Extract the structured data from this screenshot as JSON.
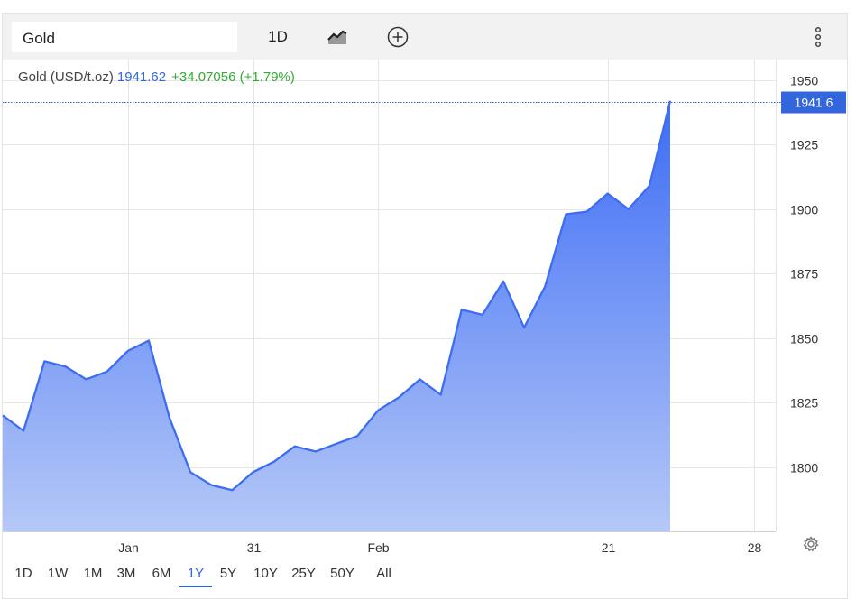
{
  "toolbar": {
    "symbol": "Gold",
    "interval": "1D",
    "chart_type_icon": "mountain-chart-icon",
    "compare_icon": "plus-circle-icon",
    "menu_icon": "vertical-ellipsis-icon"
  },
  "legend": {
    "name": "Gold (USD/t.oz)",
    "price": "1941.62",
    "change": "+34.07056 (+1.79%)"
  },
  "colors": {
    "line": "#3d6df0",
    "area_top": "#3d6cf5",
    "area_bottom": "#b5c8f7",
    "price_tag": "#3366dd",
    "change_positive": "#33aa33",
    "grid": "#e6e6e6"
  },
  "ranges": [
    "1D",
    "1W",
    "1M",
    "3M",
    "6M",
    "1Y",
    "5Y",
    "10Y",
    "25Y",
    "50Y",
    "All"
  ],
  "active_range": "1Y",
  "settings_icon": "gear-icon",
  "chart_data": {
    "type": "area",
    "title": "",
    "xlabel": "",
    "ylabel": "",
    "ylim": [
      1775,
      1958
    ],
    "grid": true,
    "y_ticks": [
      "1950",
      "1925",
      "1900",
      "1875",
      "1850",
      "1825",
      "1800"
    ],
    "x_ticks": [
      {
        "label": "Jan",
        "x": 6
      },
      {
        "label": "31",
        "x": 12
      },
      {
        "label": "Feb",
        "x": 18
      },
      {
        "label": "21",
        "x": 29
      },
      {
        "label": "28",
        "x": 36
      }
    ],
    "x_max": 37,
    "current_price_label": "1941.6",
    "current_value": 1941.62,
    "series": [
      {
        "values": [
          1820,
          1814,
          1841,
          1839,
          1834,
          1837,
          1845,
          1849,
          1819,
          1798,
          1793,
          1791,
          1798,
          1802,
          1808,
          1806,
          1809,
          1812,
          1822,
          1827,
          1834,
          1828,
          1861,
          1859,
          1872,
          1854,
          1870,
          1898,
          1899,
          1906,
          1900,
          1909,
          1942
        ]
      }
    ]
  }
}
